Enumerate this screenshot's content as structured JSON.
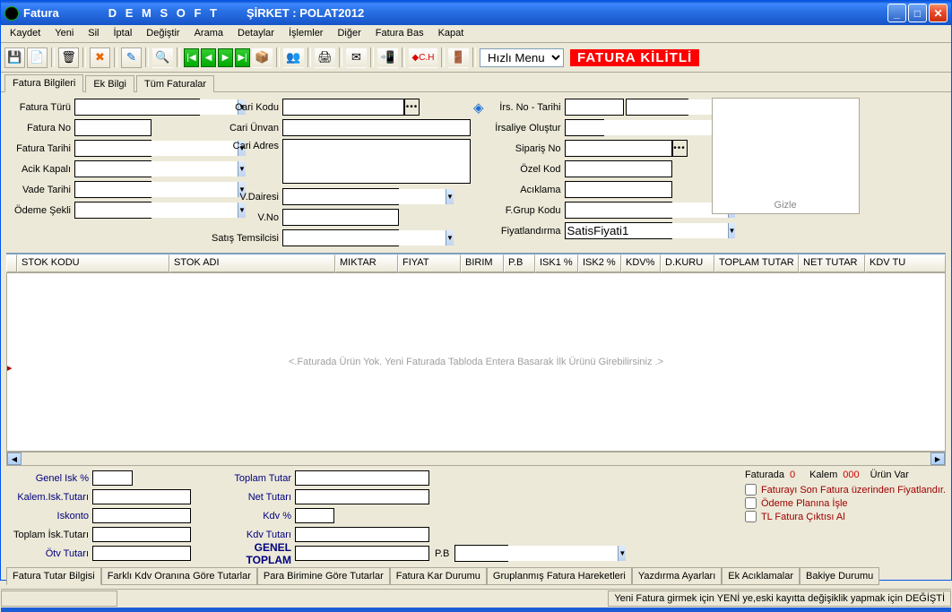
{
  "title": {
    "main": "Fatura",
    "soft": "D E M S O F T",
    "firma": "ŞİRKET : POLAT2012"
  },
  "menu": [
    "Kaydet",
    "Yeni",
    "Sil",
    "İptal",
    "Değiştir",
    "Arama",
    "Detaylar",
    "İşlemler",
    "Diğer",
    "Fatura Bas",
    "Kapat"
  ],
  "toolbar": {
    "hizli": "Hızlı Menu",
    "lock": "FATURA KİLİTLİ",
    "ch": "C.H"
  },
  "tabs": [
    "Fatura Bilgileri",
    "Ek Bilgi",
    "Tüm Faturalar"
  ],
  "form": {
    "c1": {
      "fatura_turu": "Fatura Türü",
      "fatura_no": "Fatura No",
      "fatura_tarihi": "Fatura Tarihi",
      "acik_kapali": "Acik Kapalı",
      "vade_tarihi": "Vade Tarihi",
      "odeme_sekli": "Ödeme Şekli"
    },
    "c2": {
      "cari_kodu": "Cari Kodu",
      "cari_unvan": "Cari Ünvan",
      "cari_adres": "Cari Adres",
      "vdairesi": "V.Dairesi",
      "vno": "V.No",
      "satis_tems": "Satış Temsilcisi"
    },
    "c3": {
      "irs_no_tarihi": "İrs. No - Tarihi",
      "irsaliye_olustur": "İrsaliye Oluştur",
      "siparis_no": "Sipariş No",
      "ozel_kod": "Özel Kod",
      "aciklama": "Acıklama",
      "fgrup_kodu": "F.Grup Kodu",
      "fiyatlandirma": "Fiyatlandırma",
      "fiyatlandirma_val": "SatisFiyati1"
    },
    "gizle": "Gizle"
  },
  "grid": {
    "cols": [
      "STOK KODU",
      "STOK ADI",
      "MIKTAR",
      "FIYAT",
      "BIRIM",
      "P.B",
      "ISK1 %",
      "ISK2 %",
      "KDV%",
      "D.KURU",
      "TOPLAM TUTAR",
      "NET TUTAR",
      "KDV TU"
    ],
    "empty": "<.Faturada Ürün Yok. Yeni Faturada Tabloda Entera Basarak İlk Ürünü Girebilirsiniz .>"
  },
  "totals": {
    "left": {
      "genel_isk": "Genel Isk %",
      "kalem_isk_tutari": "Kalem.Isk.Tutarı",
      "iskonto": "Iskonto",
      "toplam_isk_tutari": "Toplam İsk.Tutarı",
      "otv_tutari": "Ötv Tutarı"
    },
    "mid": {
      "toplam_tutar": "Toplam Tutar",
      "net_tutari": "Net Tutarı",
      "kdv_pct": "Kdv %",
      "kdv_tutari": "Kdv Tutarı",
      "genel_toplam": "GENEL TOPLAM",
      "pb": "P.B"
    }
  },
  "summary": {
    "faturada": "Faturada",
    "faturada_v": "0",
    "kalem": "Kalem",
    "kalem_v": "000",
    "urun_var": "Ürün Var",
    "chk1": "Faturayı Son Fatura üzerinden Fiyatlandır.",
    "chk2": "Ödeme Planına İşle",
    "chk3": "TL Fatura Çıktısı Al"
  },
  "bottom_tabs": [
    "Fatura Tutar Bilgisi",
    "Farklı Kdv Oranına Göre Tutarlar",
    "Para Birimine Göre Tutarlar",
    "Fatura Kar Durumu",
    "Gruplanmış Fatura Hareketleri",
    "Yazdırma Ayarları",
    "Ek Acıklamalar",
    "Bakiye Durumu"
  ],
  "status": "Yeni Fatura girmek için YENİ ye,eski kayıtta değişiklik yapmak için DEĞİŞTİ"
}
